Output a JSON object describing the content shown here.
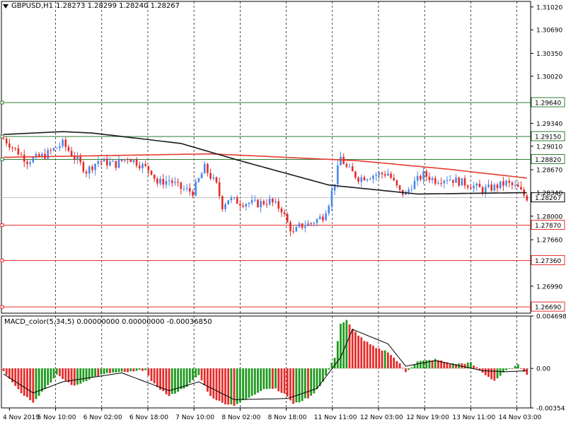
{
  "header": {
    "symbol": "GBPUSD,H1",
    "ohlc": "1.28273 1.28299 1.28240 1.28267"
  },
  "macd": {
    "label": "MACD_color(5,34,5) 0.00000000 0.00000000 -0.00036850"
  },
  "colors": {
    "bull": "#4a86e8",
    "bear": "#e52b2b",
    "ma_red": "#e53b2f",
    "ma_black": "#1a1a1a",
    "support_line": "#e53030",
    "resistance_line": "#2e7d32",
    "macd_pos": "#1f9a1f",
    "macd_neg": "#e52b2b"
  },
  "chart_data": [
    {
      "type": "candlestick",
      "title": "GBPUSD,H1",
      "ylim": [
        1.266,
        1.311
      ],
      "y_ticks": [
        "1.31020",
        "1.30690",
        "1.30350",
        "1.30020",
        "1.29340",
        "1.29010",
        "1.28670",
        "1.28340",
        "1.28000",
        "1.27660",
        "1.26990"
      ],
      "x_ticks": [
        "4 Nov 2019",
        "5 Nov 10:00",
        "6 Nov 02:00",
        "6 Nov 18:00",
        "7 Nov 10:00",
        "8 Nov 02:00",
        "8 Nov 18:00",
        "11 Nov 11:00",
        "12 Nov 03:00",
        "12 Nov 19:00",
        "13 Nov 11:00",
        "14 Nov 03:00"
      ],
      "current_price": "1.28267",
      "levels": [
        {
          "label": "1.29640",
          "value": 1.2964,
          "kind": "resistance"
        },
        {
          "label": "1.29150",
          "value": 1.2915,
          "kind": "resistance"
        },
        {
          "label": "1.28820",
          "value": 1.2882,
          "kind": "resistance"
        },
        {
          "label": "1.27870",
          "value": 1.2787,
          "kind": "support"
        },
        {
          "label": "1.27360",
          "value": 1.2736,
          "kind": "support"
        },
        {
          "label": "1.26690",
          "value": 1.2669,
          "kind": "support"
        }
      ],
      "close_path": [
        [
          0,
          1.2912
        ],
        [
          8,
          1.288
        ],
        [
          14,
          1.2888
        ],
        [
          20,
          1.2905
        ],
        [
          24,
          1.2885
        ],
        [
          28,
          1.2865
        ],
        [
          32,
          1.288
        ],
        [
          38,
          1.2875
        ],
        [
          42,
          1.2885
        ],
        [
          46,
          1.2875
        ],
        [
          50,
          1.2865
        ],
        [
          52,
          1.2848
        ],
        [
          56,
          1.2852
        ],
        [
          60,
          1.284
        ],
        [
          64,
          1.2835
        ],
        [
          68,
          1.287
        ],
        [
          72,
          1.2845
        ],
        [
          74,
          1.2815
        ],
        [
          76,
          1.2825
        ],
        [
          80,
          1.282
        ],
        [
          86,
          1.2818
        ],
        [
          90,
          1.2822
        ],
        [
          94,
          1.281
        ],
        [
          96,
          1.279
        ],
        [
          98,
          1.2775
        ],
        [
          100,
          1.2785
        ],
        [
          104,
          1.279
        ],
        [
          108,
          1.28
        ],
        [
          110,
          1.282
        ],
        [
          112,
          1.285
        ],
        [
          114,
          1.2885
        ],
        [
          116,
          1.287
        ],
        [
          120,
          1.2855
        ],
        [
          126,
          1.286
        ],
        [
          130,
          1.2862
        ],
        [
          134,
          1.2835
        ],
        [
          136,
          1.2832
        ],
        [
          138,
          1.2845
        ],
        [
          142,
          1.286
        ],
        [
          146,
          1.2852
        ],
        [
          150,
          1.2855
        ],
        [
          154,
          1.285
        ],
        [
          158,
          1.2845
        ],
        [
          162,
          1.2838
        ],
        [
          166,
          1.2842
        ],
        [
          170,
          1.2848
        ],
        [
          174,
          1.284
        ],
        [
          176,
          1.283
        ],
        [
          177,
          1.2827
        ]
      ],
      "ma_red": [
        [
          0,
          1.2885
        ],
        [
          70,
          1.289
        ],
        [
          120,
          1.288
        ],
        [
          150,
          1.2868
        ],
        [
          177,
          1.2855
        ]
      ],
      "ma_black": [
        [
          0,
          1.2918
        ],
        [
          20,
          1.2922
        ],
        [
          30,
          1.292
        ],
        [
          60,
          1.2905
        ],
        [
          80,
          1.288
        ],
        [
          110,
          1.2845
        ],
        [
          140,
          1.2832
        ],
        [
          177,
          1.2834
        ]
      ]
    },
    {
      "type": "bar",
      "title": "MACD_color(5,34,5)",
      "ylim": [
        -0.003541,
        0.004698
      ],
      "y_ticks": [
        "0.0046980",
        "0.00",
        "-0.003541"
      ],
      "histogram_path": [
        [
          0,
          -0.0002
        ],
        [
          6,
          -0.0022
        ],
        [
          10,
          -0.003
        ],
        [
          14,
          -0.0018
        ],
        [
          18,
          -0.0006
        ],
        [
          24,
          -0.0016
        ],
        [
          30,
          -0.0008
        ],
        [
          36,
          -0.0004
        ],
        [
          44,
          -0.0003
        ],
        [
          48,
          -0.0001
        ],
        [
          50,
          -0.0012
        ],
        [
          56,
          -0.0025
        ],
        [
          62,
          -0.0016
        ],
        [
          66,
          -0.0006
        ],
        [
          70,
          -0.0025
        ],
        [
          74,
          -0.0031
        ],
        [
          78,
          -0.0033
        ],
        [
          84,
          -0.0025
        ],
        [
          88,
          -0.0018
        ],
        [
          92,
          -0.0018
        ],
        [
          96,
          -0.0025
        ],
        [
          98,
          -0.0032
        ],
        [
          100,
          -0.003
        ],
        [
          104,
          -0.0025
        ],
        [
          108,
          -0.0012
        ],
        [
          112,
          0.001
        ],
        [
          114,
          0.004
        ],
        [
          116,
          0.0043
        ],
        [
          118,
          0.0035
        ],
        [
          122,
          0.0025
        ],
        [
          126,
          0.0018
        ],
        [
          130,
          0.0015
        ],
        [
          134,
          0.0004
        ],
        [
          136,
          -0.0003
        ],
        [
          140,
          0.0006
        ],
        [
          146,
          0.0008
        ],
        [
          152,
          0.0004
        ],
        [
          158,
          0.0005
        ],
        [
          162,
          -0.0004
        ],
        [
          166,
          -0.0011
        ],
        [
          170,
          -0.0002
        ],
        [
          174,
          0.0003
        ],
        [
          177,
          -0.0005
        ]
      ],
      "signal_path": [
        [
          0,
          -0.0005
        ],
        [
          10,
          -0.0022
        ],
        [
          20,
          -0.0012
        ],
        [
          40,
          -0.0004
        ],
        [
          56,
          -0.002
        ],
        [
          66,
          -0.0012
        ],
        [
          78,
          -0.0028
        ],
        [
          96,
          -0.0027
        ],
        [
          106,
          -0.0018
        ],
        [
          114,
          0.001
        ],
        [
          118,
          0.0035
        ],
        [
          130,
          0.0022
        ],
        [
          136,
          0.0002
        ],
        [
          146,
          0.0007
        ],
        [
          162,
          -0.0002
        ],
        [
          170,
          -0.0003
        ],
        [
          177,
          -0.0002
        ]
      ]
    }
  ]
}
